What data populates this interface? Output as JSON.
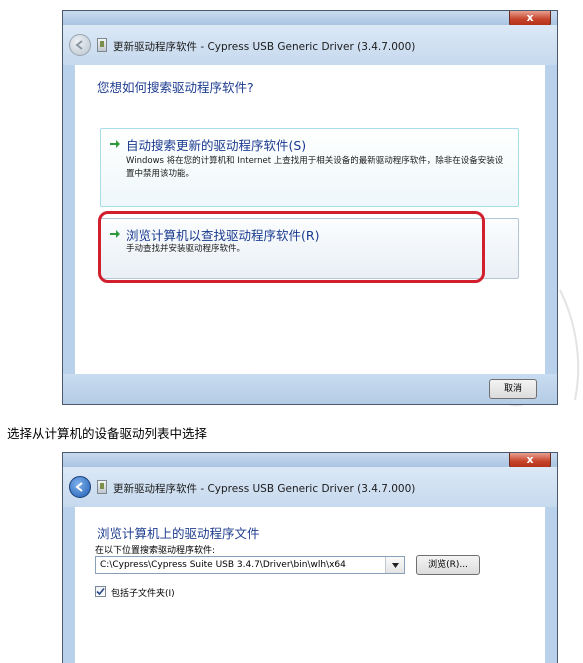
{
  "window1": {
    "close_label": "x",
    "title": "更新驱动程序软件 - Cypress USB Generic Driver (3.4.7.000)",
    "heading": "您想如何搜索驱动程序软件?",
    "option_auto": {
      "title": "自动搜索更新的驱动程序软件(S)",
      "description": "Windows 将在您的计算机和 Internet 上查找用于相关设备的最新驱动程序软件，除非在设备安装设置中禁用该功能。"
    },
    "option_browse": {
      "title": "浏览计算机以查找驱动程序软件(R)",
      "description": "手动查找并安装驱动程序软件。"
    },
    "cancel_label": "取消",
    "highlight_color": "#d21f2e"
  },
  "caption": "选择从计算机的设备驱动列表中选择",
  "window2": {
    "close_label": "x",
    "title": "更新驱动程序软件 - Cypress USB Generic Driver (3.4.7.000)",
    "heading": "浏览计算机上的驱动程序文件",
    "search_label": "在以下位置搜索驱动程序软件:",
    "path_value": "C:\\Cypress\\Cypress Suite USB 3.4.7\\Driver\\bin\\wlh\\x64",
    "browse_label": "浏览(R)...",
    "include_subfolders_label": "包括子文件夹(I)",
    "include_subfolders_checked": true
  },
  "icons": [
    "back-arrow-icon",
    "driver-icon",
    "green-arrow-icon",
    "close-icon",
    "dropdown-arrow-icon",
    "checkmark-icon"
  ],
  "colors": {
    "title_blue": "#1e3d8f",
    "arrow_green": "#2f9a3b",
    "close_red": "#c7432b"
  }
}
